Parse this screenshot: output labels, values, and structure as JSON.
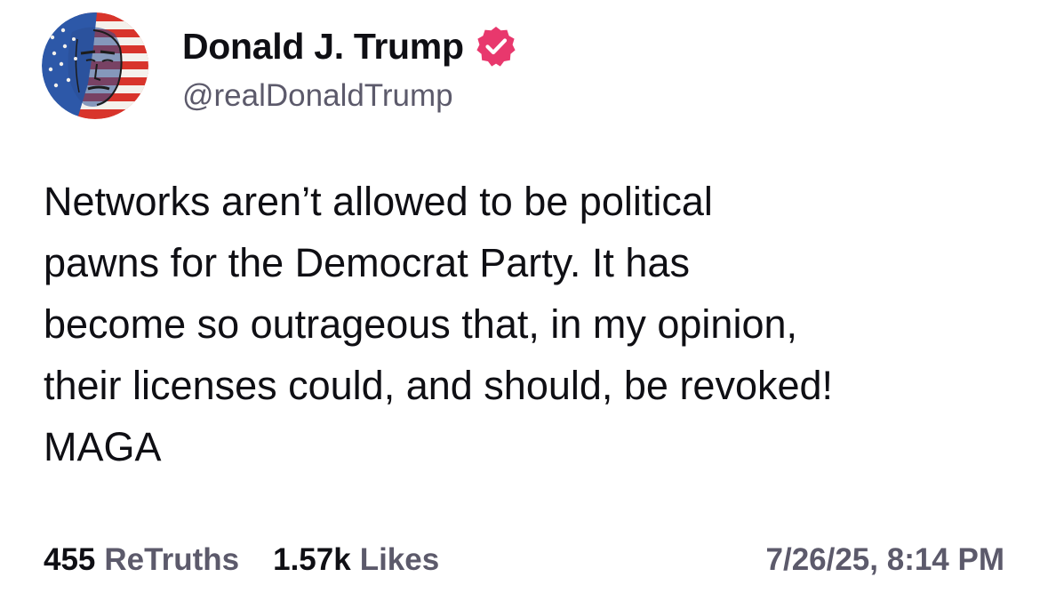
{
  "author": {
    "display_name": "Donald J. Trump",
    "handle": "@realDonaldTrump",
    "verified": true,
    "avatar_icon": "user-avatar",
    "badge_icon": "verified-badge-icon",
    "badge_color": "#e8386d"
  },
  "post": {
    "lines": [
      "Networks aren’t allowed to be political",
      "pawns for the Democrat Party. It has",
      "become so outrageous that, in my opinion,",
      "their licenses could, and should, be revoked!",
      "MAGA"
    ]
  },
  "stats": {
    "retruths_count": "455",
    "retruths_label": "ReTruths",
    "likes_count": "1.57k",
    "likes_label": "Likes"
  },
  "timestamp": "7/26/25, 8:14 PM"
}
